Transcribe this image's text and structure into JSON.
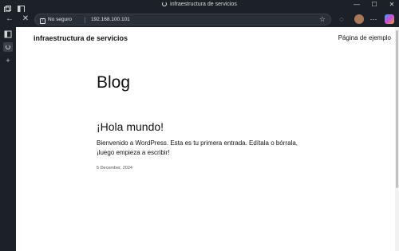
{
  "browser": {
    "tab_title": "infraestructura de servicios",
    "security_label": "No seguro",
    "url": "192.168.100.101",
    "window_controls": {
      "minimize": "—",
      "maximize": "☐",
      "close": "✕"
    }
  },
  "page": {
    "site_title": "infraestructura de servicios",
    "nav_link": "Página de ejemplo",
    "heading": "Blog",
    "post": {
      "title": "¡Hola mundo!",
      "excerpt": "Bienvenido a WordPress. Esta es tu primera entrada. Edítala o bórrala, ¡luego empieza a escribir!",
      "date": "5 December, 2024"
    }
  }
}
